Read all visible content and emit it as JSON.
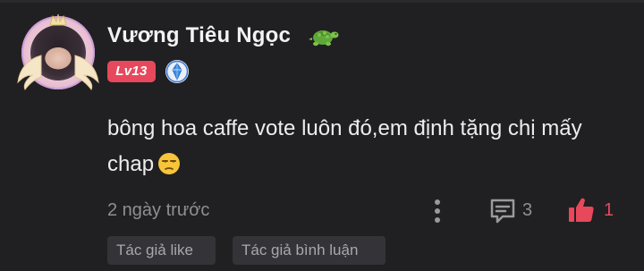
{
  "user": {
    "name": "Vương Tiêu Ngọc",
    "level": "Lv13",
    "name_icon": "turtle-emoji-icon",
    "rank_icon": "blue-crystal-badge-icon"
  },
  "comment": {
    "text": "bông hoa caffe vote luôn đó,em định tặng chị mấy chap",
    "emoji": "unamused-face-emoji"
  },
  "footer": {
    "timestamp": "2 ngày trước",
    "reply_count": "3",
    "like_count": "1"
  },
  "tags": {
    "author_like": "Tác giả like",
    "author_comment": "Tác giả bình luận"
  },
  "colors": {
    "background": "#202022",
    "level_badge": "#e8485c",
    "like_active": "#e8485c",
    "muted_text": "#8f8f93",
    "tag_bg": "#343438"
  }
}
